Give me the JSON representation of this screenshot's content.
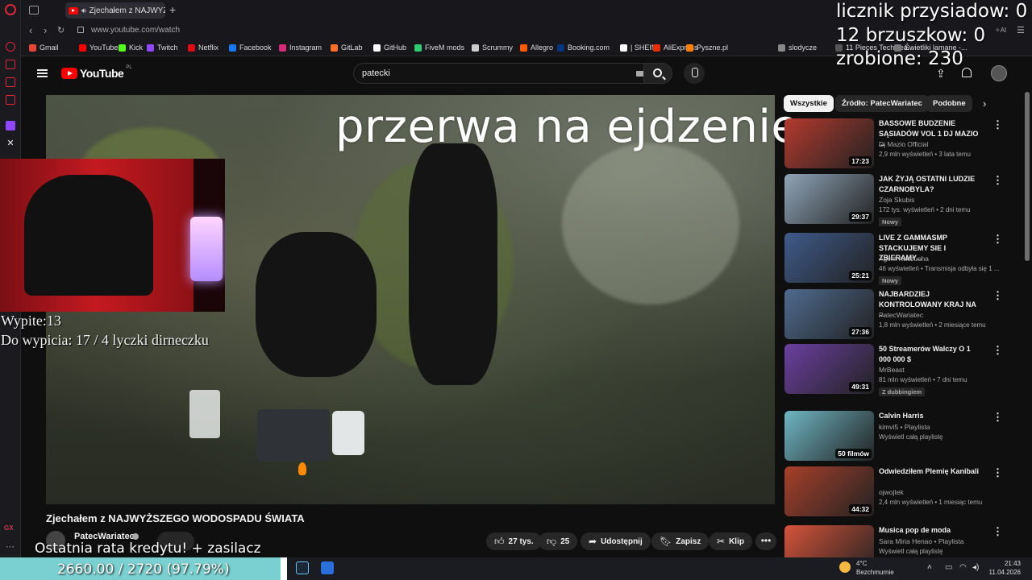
{
  "browser": {
    "tab_title": "Zjechałem z NAJWYŻS",
    "url": "www.youtube.com/watch",
    "bookmarks": [
      {
        "label": "Gmail",
        "color": "#ea4335"
      },
      {
        "label": "YouTube",
        "color": "#ff0000"
      },
      {
        "label": "Kick",
        "color": "#53fc18"
      },
      {
        "label": "Twitch",
        "color": "#9146ff"
      },
      {
        "label": "Netflix",
        "color": "#e50914"
      },
      {
        "label": "Facebook",
        "color": "#1877f2"
      },
      {
        "label": "Instagram",
        "color": "#d62976"
      },
      {
        "label": "GitLab",
        "color": "#fc6d26"
      },
      {
        "label": "GitHub",
        "color": "#ffffff"
      },
      {
        "label": "FiveM mods",
        "color": "#2ecc71"
      },
      {
        "label": "Scrummy",
        "color": "#cccccc"
      },
      {
        "label": "Allegro",
        "color": "#ff5a00"
      },
      {
        "label": "Booking.com",
        "color": "#003580"
      },
      {
        "label": "| SHEIN",
        "color": "#ffffff"
      },
      {
        "label": "AliExpress",
        "color": "#e62e04"
      },
      {
        "label": "Pyszne.pl",
        "color": "#ff8000"
      },
      {
        "label": "slodycze",
        "color": "#888888"
      },
      {
        "label": "11 Pieces Techwea...",
        "color": "#555555"
      },
      {
        "label": "Świetliki lamane -...",
        "color": "#777777"
      }
    ]
  },
  "youtube": {
    "logo_text": "YouTube",
    "logo_region": "PL",
    "search_query": "patecki"
  },
  "video": {
    "title": "Zjechałem z NAJWYŻSZEGO WODOSPADU ŚWIATA",
    "channel": "PatecWariatec",
    "likes": "27 tys.",
    "dislikes": "25",
    "share_label": "Udostępnij",
    "save_label": "Zapisz",
    "clip_label": "Klip",
    "more": "•••"
  },
  "overlays": {
    "break_text": "przerwa na ejdzenie",
    "drunk": "Wypite:13",
    "to_drink": "Do wypicia: 17 / 4 lyczki dirneczku",
    "squats": "licznik przysiadow: 0",
    "crunches": "12 brzuszkow: 0",
    "done": "zrobione: 230",
    "credit_label": "Ostatnia rata kredytu! + zasilacz",
    "credit_progress": "2660.00 / 2720 (97.79%)",
    "credit_fraction": 0.9779
  },
  "chips": [
    "Wszystkie",
    "Źródło: PatecWariatec",
    "Podobne"
  ],
  "recommendations": [
    {
      "title": "BASSOWE BUDZENIE SĄSIADÓW VOL 1 DJ MAZIO ...",
      "channel": "Dj Mazio Official",
      "meta": "2,9 mln wyświetleń • 3 lata temu",
      "duration": "17:23",
      "badge": "",
      "thumb": "#b43a2f"
    },
    {
      "title": "JAK ŻYJĄ OSTATNI LUDZIE CZARNOBYLA?",
      "channel": "Zoja Skubis",
      "meta": "172 tys. wyświetleń • 2 dni temu",
      "duration": "29:37",
      "badge": "Nowy",
      "thumb": "#8fa5b8"
    },
    {
      "title": "LIVE Z GAMMASMP STACKUJEMY SIE I ZBIERAMY...",
      "channel": "Agent Kaczucha",
      "meta": "46 wyświetleń • Transmisja odbyła się 1 ...",
      "duration": "25:21",
      "badge": "Nowy",
      "thumb": "#3f5a8a"
    },
    {
      "title": "NAJBARDZIEJ KONTROLOWANY KRAJ NA ...",
      "channel": "PatecWariatec",
      "meta": "1,8 mln wyświetleń • 2 miesiące temu",
      "duration": "27:36",
      "badge": "",
      "thumb": "#4f6b8f"
    },
    {
      "title": "50 Streamerów Walczy O 1 000 000 $",
      "channel": "MrBeast",
      "meta": "81 mln wyświetleń • 7 dni temu",
      "duration": "49:31",
      "badge": "Z dubbingiem",
      "thumb": "#6b3fa0"
    },
    {
      "title": "Calvin Harris",
      "channel": "kimvi5 • Playlista",
      "meta": "Wyświetl całą playlistę",
      "duration": "50 filmów",
      "badge": "",
      "thumb": "#6fb6c4"
    },
    {
      "title": "Odwiedziłem Plemię Kanibali",
      "channel": "ojwojtek",
      "meta": "2,4 mln wyświetleń • 1 miesiąc temu",
      "duration": "44:32",
      "badge": "",
      "thumb": "#a8402a"
    },
    {
      "title": "Musica pop de moda",
      "channel": "Sara Miria Henao • Playlista",
      "meta": "Wyświetl całą playlistę",
      "duration": "",
      "badge": "",
      "thumb": "#d6533a"
    }
  ],
  "taskbar": {
    "weather_temp": "4°C",
    "weather_desc": "Bezchmurnie",
    "time": "21:43",
    "date": "11.04.2026"
  },
  "icons": {
    "sidebar": [
      "opera-logo",
      "history-icon",
      "bag-icon",
      "news-icon",
      "mail-icon",
      "twitch-icon",
      "x-icon"
    ]
  }
}
